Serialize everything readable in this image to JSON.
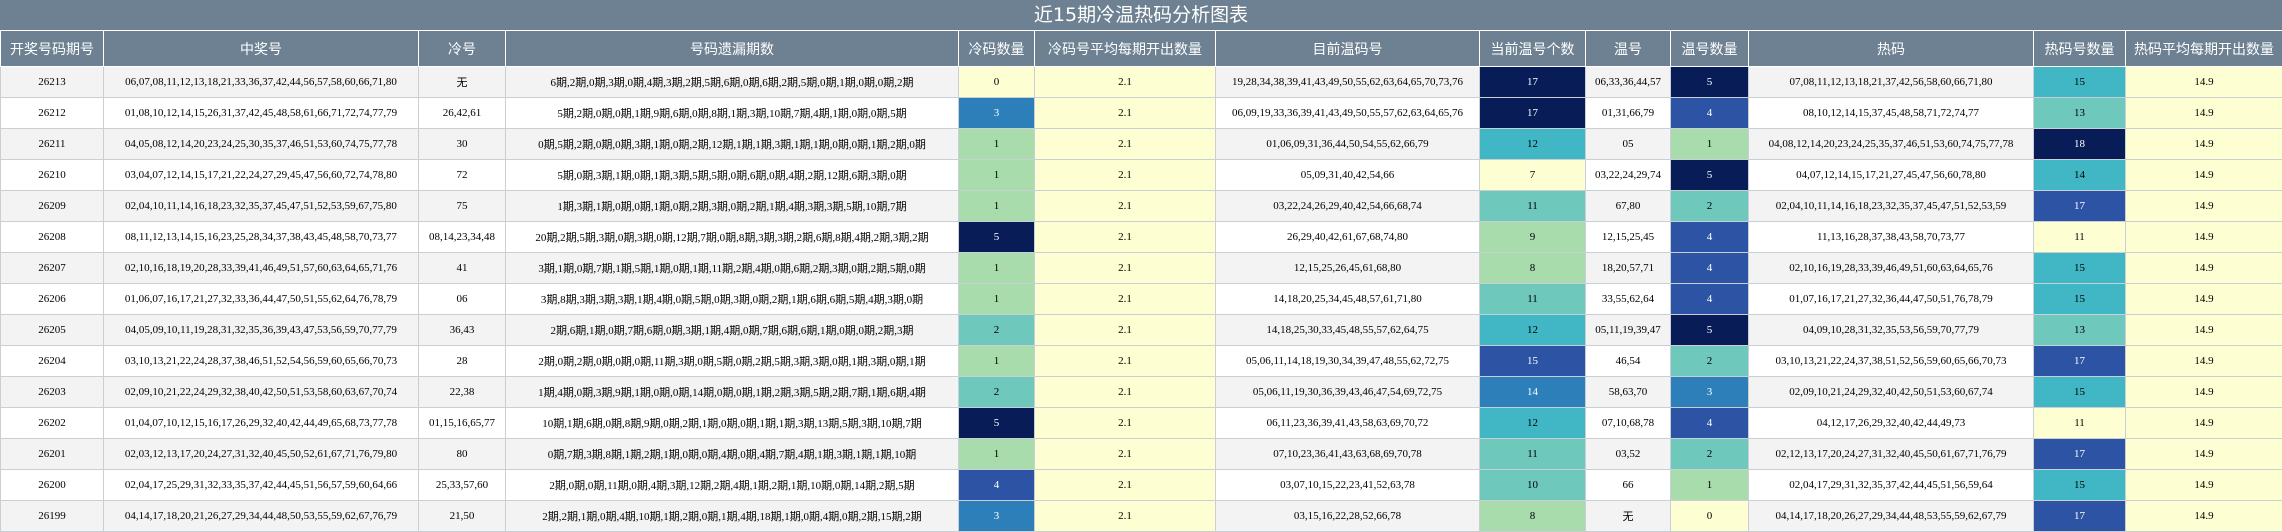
{
  "title": "近15期冷温热码分析图表",
  "headers": [
    "开奖号码期号",
    "中奖号",
    "冷号",
    "号码遗漏期数",
    "冷码数量",
    "冷码号平均每期开出数量",
    "目前温码号",
    "当前温号个数",
    "温号",
    "温号数量",
    "热码",
    "热码号数量",
    "热码平均每期开出数量"
  ],
  "colors": {
    "header_bg": "#6d8192",
    "avg_bg": "#fdffd2",
    "scale": [
      "#fdffd2",
      "#a8dcad",
      "#6ec8bb",
      "#41b6c4",
      "#2c7fb8",
      "#2d54a4",
      "#081d58"
    ]
  },
  "chart_data": {
    "type": "table",
    "title": "近15期冷温热码分析图表",
    "columns": [
      "开奖号码期号",
      "中奖号",
      "冷号",
      "号码遗漏期数",
      "冷码数量",
      "冷码号平均每期开出数量",
      "目前温码号",
      "当前温号个数",
      "温号",
      "温号数量",
      "热码",
      "热码号数量",
      "热码平均每期开出数量"
    ],
    "rows": [
      [
        "26213",
        "06,07,08,11,12,13,18,21,33,36,37,42,44,56,57,58,60,66,71,80",
        "无",
        "6期,2期,0期,3期,0期,4期,3期,2期,5期,6期,0期,6期,2期,5期,0期,1期,0期,0期,2期",
        "0",
        "2.1",
        "19,28,34,38,39,41,43,49,50,55,62,63,64,65,70,73,76",
        "17",
        "06,33,36,44,57",
        "5",
        "07,08,11,12,13,18,21,37,42,56,58,60,66,71,80",
        "15",
        "14.9"
      ],
      [
        "26212",
        "01,08,10,12,14,15,26,31,37,42,45,48,58,61,66,71,72,74,77,79",
        "26,42,61",
        "5期,2期,0期,0期,1期,9期,6期,0期,8期,1期,3期,10期,7期,4期,1期,0期,0期,5期",
        "3",
        "2.1",
        "06,09,19,33,36,39,41,43,49,50,55,57,62,63,64,65,76",
        "17",
        "01,31,66,79",
        "4",
        "08,10,12,14,15,37,45,48,58,71,72,74,77",
        "13",
        "14.9"
      ],
      [
        "26211",
        "04,05,08,12,14,20,23,24,25,30,35,37,46,51,53,60,74,75,77,78",
        "30",
        "0期,5期,2期,0期,0期,3期,1期,0期,2期,12期,1期,1期,3期,1期,1期,0期,0期,1期,2期,0期",
        "1",
        "2.1",
        "01,06,09,31,36,44,50,54,55,62,66,79",
        "12",
        "05",
        "1",
        "04,08,12,14,20,23,24,25,35,37,46,51,53,60,74,75,77,78",
        "18",
        "14.9"
      ],
      [
        "26210",
        "03,04,07,12,14,15,17,21,22,24,27,29,45,47,56,60,72,74,78,80",
        "72",
        "5期,0期,3期,1期,0期,1期,3期,5期,5期,0期,6期,0期,4期,2期,12期,6期,3期,0期",
        "1",
        "2.1",
        "05,09,31,40,42,54,66",
        "7",
        "03,22,24,29,74",
        "5",
        "04,07,12,14,15,17,21,27,45,47,56,60,78,80",
        "14",
        "14.9"
      ],
      [
        "26209",
        "02,04,10,11,14,16,18,23,32,35,37,45,47,51,52,53,59,67,75,80",
        "75",
        "1期,3期,1期,0期,0期,1期,0期,2期,3期,0期,2期,1期,4期,3期,3期,5期,10期,7期",
        "1",
        "2.1",
        "03,22,24,26,29,40,42,54,66,68,74",
        "11",
        "67,80",
        "2",
        "02,04,10,11,14,16,18,23,32,35,37,45,47,51,52,53,59",
        "17",
        "14.9"
      ],
      [
        "26208",
        "08,11,12,13,14,15,16,23,25,28,34,37,38,43,45,48,58,70,73,77",
        "08,14,23,34,48",
        "20期,2期,5期,3期,0期,3期,0期,12期,7期,0期,8期,3期,3期,2期,6期,8期,4期,2期,3期,2期",
        "5",
        "2.1",
        "26,29,40,42,61,67,68,74,80",
        "9",
        "12,15,25,45",
        "4",
        "11,13,16,28,37,38,43,58,70,73,77",
        "11",
        "14.9"
      ],
      [
        "26207",
        "02,10,16,18,19,20,28,33,39,41,46,49,51,57,60,63,64,65,71,76",
        "41",
        "3期,1期,0期,7期,1期,5期,1期,0期,1期,11期,2期,4期,0期,6期,2期,3期,0期,2期,5期,0期",
        "1",
        "2.1",
        "12,15,25,26,45,61,68,80",
        "8",
        "18,20,57,71",
        "4",
        "02,10,16,19,28,33,39,46,49,51,60,63,64,65,76",
        "15",
        "14.9"
      ],
      [
        "26206",
        "01,06,07,16,17,21,27,32,33,36,44,47,50,51,55,62,64,76,78,79",
        "06",
        "3期,8期,3期,3期,3期,1期,4期,0期,5期,0期,3期,0期,2期,1期,6期,6期,5期,4期,3期,0期",
        "1",
        "2.1",
        "14,18,20,25,34,45,48,57,61,71,80",
        "11",
        "33,55,62,64",
        "4",
        "01,07,16,17,21,27,32,36,44,47,50,51,76,78,79",
        "15",
        "14.9"
      ],
      [
        "26205",
        "04,05,09,10,11,19,28,31,32,35,36,39,43,47,53,56,59,70,77,79",
        "36,43",
        "2期,6期,1期,0期,7期,6期,0期,3期,1期,4期,0期,7期,6期,6期,1期,0期,0期,2期,3期",
        "2",
        "2.1",
        "14,18,25,30,33,45,48,55,57,62,64,75",
        "12",
        "05,11,19,39,47",
        "5",
        "04,09,10,28,31,32,35,53,56,59,70,77,79",
        "13",
        "14.9"
      ],
      [
        "26204",
        "03,10,13,21,22,24,28,37,38,46,51,52,54,56,59,60,65,66,70,73",
        "28",
        "2期,0期,2期,0期,0期,0期,11期,3期,0期,5期,0期,2期,5期,3期,3期,0期,1期,3期,0期,1期",
        "1",
        "2.1",
        "05,06,11,14,18,19,30,34,39,47,48,55,62,72,75",
        "15",
        "46,54",
        "2",
        "03,10,13,21,22,24,37,38,51,52,56,59,60,65,66,70,73",
        "17",
        "14.9"
      ],
      [
        "26203",
        "02,09,10,21,22,24,29,32,38,40,42,50,51,53,58,60,63,67,70,74",
        "22,38",
        "1期,4期,0期,3期,9期,1期,0期,0期,14期,0期,0期,1期,2期,3期,5期,2期,7期,1期,6期,4期",
        "2",
        "2.1",
        "05,06,11,19,30,36,39,43,46,47,54,69,72,75",
        "14",
        "58,63,70",
        "3",
        "02,09,10,21,24,29,32,40,42,50,51,53,60,67,74",
        "15",
        "14.9"
      ],
      [
        "26202",
        "01,04,07,10,12,15,16,17,26,29,32,40,42,44,49,65,68,73,77,78",
        "01,15,16,65,77",
        "10期,1期,6期,0期,8期,9期,0期,2期,1期,0期,0期,1期,1期,3期,13期,5期,3期,10期,7期",
        "5",
        "2.1",
        "06,11,23,36,39,41,43,58,63,69,70,72",
        "12",
        "07,10,68,78",
        "4",
        "04,12,17,26,29,32,40,42,44,49,73",
        "11",
        "14.9"
      ],
      [
        "26201",
        "02,03,12,13,17,20,24,27,31,32,40,45,50,52,61,67,71,76,79,80",
        "80",
        "0期,7期,3期,8期,1期,2期,1期,0期,0期,4期,0期,4期,7期,4期,1期,3期,1期,1期,10期",
        "1",
        "2.1",
        "07,10,23,36,41,43,63,68,69,70,78",
        "11",
        "03,52",
        "2",
        "02,12,13,17,20,24,27,31,32,40,45,50,61,67,71,76,79",
        "17",
        "14.9"
      ],
      [
        "26200",
        "02,04,17,25,29,31,32,33,35,37,42,44,45,51,56,57,59,60,64,66",
        "25,33,57,60",
        "2期,0期,0期,11期,0期,4期,3期,12期,2期,4期,1期,2期,1期,10期,0期,14期,2期,5期",
        "4",
        "2.1",
        "03,07,10,15,22,23,41,52,63,78",
        "10",
        "66",
        "1",
        "02,04,17,29,31,32,35,37,42,44,45,51,56,59,64",
        "15",
        "14.9"
      ],
      [
        "26199",
        "04,14,17,18,20,21,26,27,29,34,44,48,50,53,55,59,62,67,76,79",
        "21,50",
        "2期,2期,1期,0期,4期,10期,1期,2期,0期,1期,4期,18期,1期,0期,4期,0期,2期,15期,2期",
        "3",
        "2.1",
        "03,15,16,22,28,52,66,78",
        "8",
        "无",
        "0",
        "04,14,17,18,20,26,27,29,34,44,48,53,55,59,62,67,79",
        "17",
        "14.9"
      ]
    ]
  }
}
